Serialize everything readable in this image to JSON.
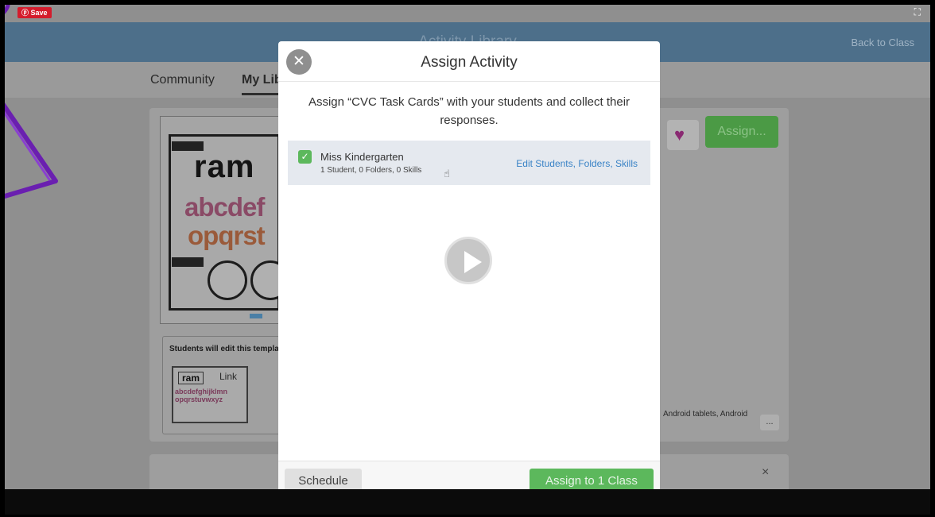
{
  "player": {
    "save_label": "Save",
    "fullscreen_icon": "fullscreen-icon"
  },
  "app": {
    "title": "Activity Library",
    "back_link": "Back to Class",
    "tabs": [
      {
        "label": "Community"
      },
      {
        "label": "My Lib"
      }
    ],
    "preview": {
      "word": "ram",
      "alphabet_line1": "abcdef",
      "alphabet_line2": "opqrst"
    },
    "template": {
      "label": "Students will edit this templa",
      "mini_word": "ram",
      "mini_link": "Link",
      "mini_alpha": "abcdefghijklmn opqrstuvwxyz"
    },
    "assign_button": "Assign...",
    "platforms": "Android tablets, Android",
    "more_button": "...",
    "close_x": "×"
  },
  "modal": {
    "title": "Assign Activity",
    "description": "Assign “CVC Task Cards” with your students and collect their responses.",
    "class_item": {
      "name": "Miss Kindergarten",
      "meta": "1 Student, 0 Folders, 0 Skills",
      "checked": true,
      "edit_link": "Edit Students, Folders, Skills"
    },
    "schedule_button": "Schedule",
    "assign_button": "Assign to 1 Class"
  },
  "colors": {
    "header_blue": "#4d6f8a",
    "green": "#5cb85c",
    "link_blue": "#3a83c6",
    "pin_red": "#d41c2c"
  }
}
